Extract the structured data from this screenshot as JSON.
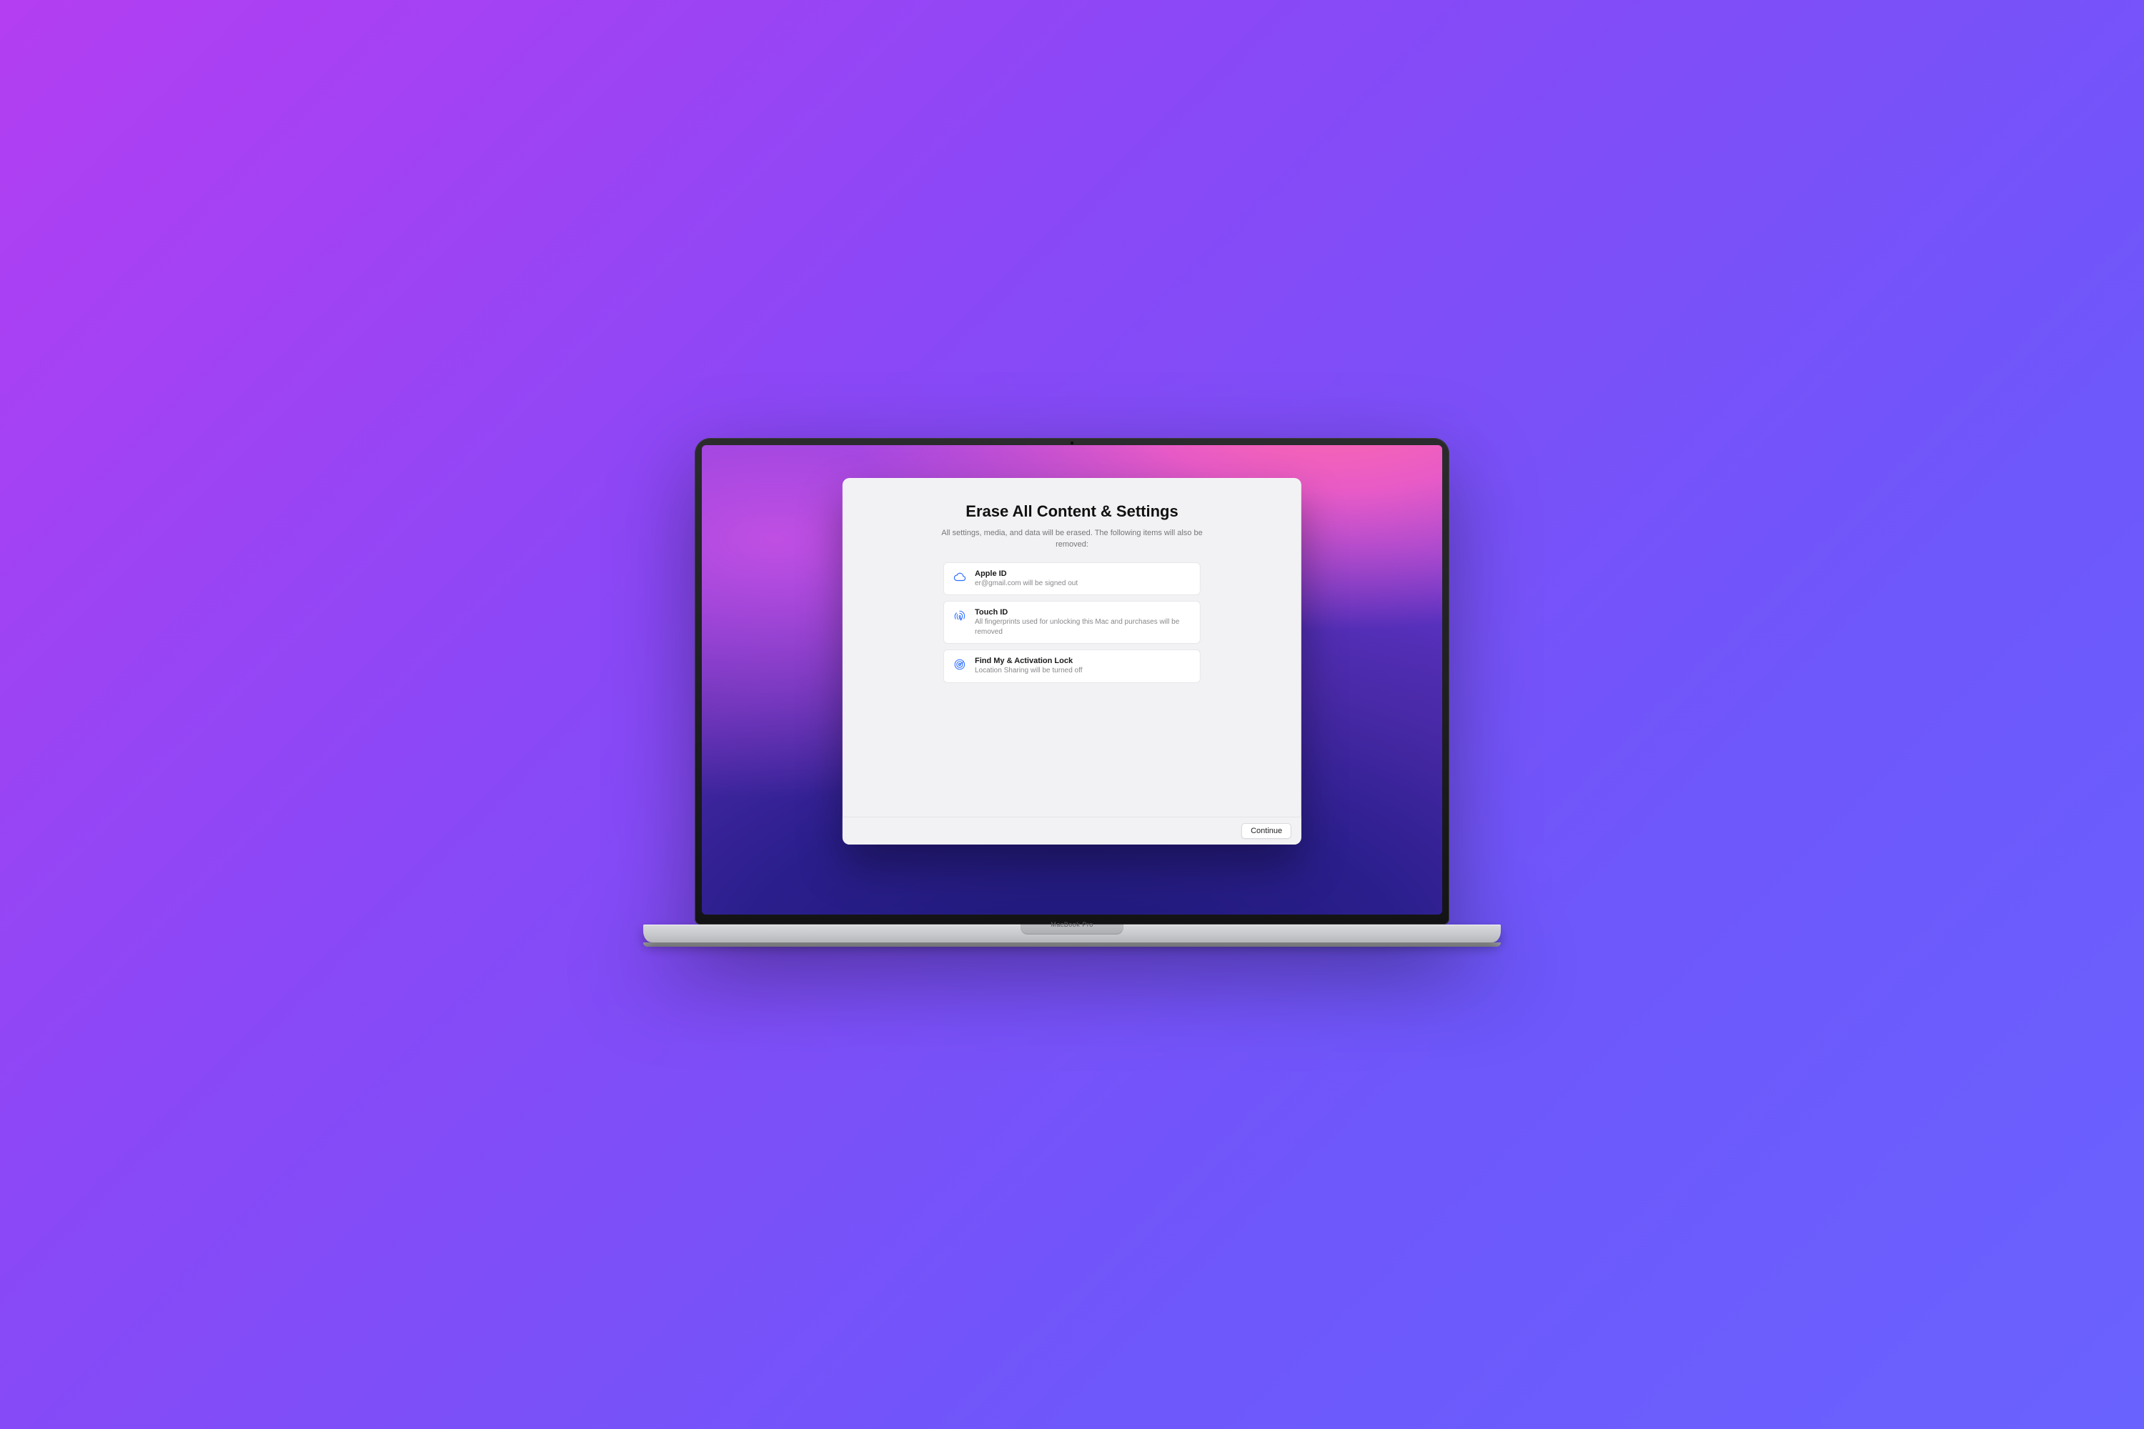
{
  "device": {
    "brand": "MacBook Pro"
  },
  "dialog": {
    "title": "Erase All Content & Settings",
    "subtitle": "All settings, media, and data will be erased. The following items will also be removed:",
    "continue_label": "Continue"
  },
  "items": [
    {
      "icon": "cloud-icon",
      "title": "Apple ID",
      "desc": "er@gmail.com will be signed out"
    },
    {
      "icon": "fingerprint-icon",
      "title": "Touch ID",
      "desc": "All fingerprints used for unlocking this Mac and purchases will be removed"
    },
    {
      "icon": "radar-icon",
      "title": "Find My & Activation Lock",
      "desc": "Location Sharing will be turned off"
    }
  ]
}
